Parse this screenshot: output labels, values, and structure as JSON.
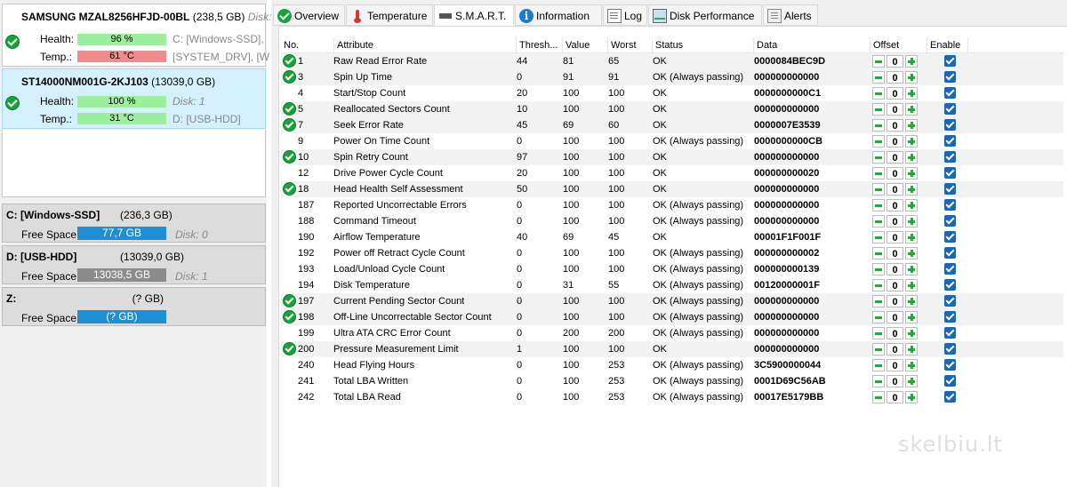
{
  "disks": [
    {
      "model": "SAMSUNG MZAL8256HFJD-00BL",
      "size": "(238,5 GB)",
      "extra": "Disk:",
      "health_label": "Health:",
      "health": "96 %",
      "temp_label": "Temp.:",
      "temp": "61 °C",
      "part1": "C: [Windows-SSD],",
      "part2": "[SYSTEM_DRV],  [W"
    },
    {
      "model": "ST14000NM001G-2KJ103",
      "size": "(13039,0 GB)",
      "health_label": "Health:",
      "health": "100 %",
      "temp_label": "Temp.:",
      "temp": "31 °C",
      "part1": "Disk: 1",
      "part2": "D: [USB-HDD]"
    }
  ],
  "volumes": [
    {
      "name": "C: [Windows-SSD]",
      "size": "(236,3 GB)",
      "free_label": "Free Space",
      "free": "77,7 GB",
      "free_fraction": 1.0,
      "disk": "Disk: 0"
    },
    {
      "name": "D: [USB-HDD]",
      "size": "(13039,0 GB)",
      "free_label": "Free Space",
      "free": "13038,5 GB",
      "free_fraction": 1.0,
      "disk": "Disk: 1"
    },
    {
      "name": "Z:",
      "size": "(? GB)",
      "free_label": "Free Space",
      "free": "(? GB)",
      "free_fraction": 1.0,
      "disk": ""
    }
  ],
  "tabs": [
    {
      "label": "Overview",
      "icon": "check-icon"
    },
    {
      "label": "Temperature",
      "icon": "thermometer-icon"
    },
    {
      "label": "S.M.A.R.T.",
      "icon": "drive-icon"
    },
    {
      "label": "Information",
      "icon": "info-icon"
    },
    {
      "label": "Log",
      "icon": "log-icon"
    },
    {
      "label": "Disk Performance",
      "icon": "chart-icon"
    },
    {
      "label": "Alerts",
      "icon": "alerts-icon"
    }
  ],
  "table": {
    "headers": [
      "No.",
      "Attribute",
      "Thresh...",
      "Value",
      "Worst",
      "Status",
      "Data",
      "Offset",
      "Enable"
    ],
    "rows": [
      {
        "ok": true,
        "no": "1",
        "attr": "Raw Read Error Rate",
        "thresh": "44",
        "value": "81",
        "worst": "65",
        "status": "OK",
        "data": "0000084BEC9D",
        "offset": "0"
      },
      {
        "ok": true,
        "no": "3",
        "attr": "Spin Up Time",
        "thresh": "0",
        "value": "91",
        "worst": "91",
        "status": "OK (Always passing)",
        "data": "000000000000",
        "offset": "0"
      },
      {
        "ok": false,
        "no": "4",
        "attr": "Start/Stop Count",
        "thresh": "20",
        "value": "100",
        "worst": "100",
        "status": "OK",
        "data": "0000000000C1",
        "offset": "0"
      },
      {
        "ok": true,
        "no": "5",
        "attr": "Reallocated Sectors Count",
        "thresh": "10",
        "value": "100",
        "worst": "100",
        "status": "OK",
        "data": "000000000000",
        "offset": "0"
      },
      {
        "ok": true,
        "no": "7",
        "attr": "Seek Error Rate",
        "thresh": "45",
        "value": "69",
        "worst": "60",
        "status": "OK",
        "data": "0000007E3539",
        "offset": "0"
      },
      {
        "ok": false,
        "no": "9",
        "attr": "Power On Time Count",
        "thresh": "0",
        "value": "100",
        "worst": "100",
        "status": "OK (Always passing)",
        "data": "0000000000CB",
        "offset": "0"
      },
      {
        "ok": true,
        "no": "10",
        "attr": "Spin Retry Count",
        "thresh": "97",
        "value": "100",
        "worst": "100",
        "status": "OK",
        "data": "000000000000",
        "offset": "0"
      },
      {
        "ok": false,
        "no": "12",
        "attr": "Drive Power Cycle Count",
        "thresh": "20",
        "value": "100",
        "worst": "100",
        "status": "OK",
        "data": "000000000020",
        "offset": "0"
      },
      {
        "ok": true,
        "no": "18",
        "attr": "Head Health Self Assessment",
        "thresh": "50",
        "value": "100",
        "worst": "100",
        "status": "OK",
        "data": "000000000000",
        "offset": "0"
      },
      {
        "ok": false,
        "no": "187",
        "attr": "Reported Uncorrectable Errors",
        "thresh": "0",
        "value": "100",
        "worst": "100",
        "status": "OK (Always passing)",
        "data": "000000000000",
        "offset": "0"
      },
      {
        "ok": false,
        "no": "188",
        "attr": "Command Timeout",
        "thresh": "0",
        "value": "100",
        "worst": "100",
        "status": "OK (Always passing)",
        "data": "000000000000",
        "offset": "0"
      },
      {
        "ok": false,
        "no": "190",
        "attr": "Airflow Temperature",
        "thresh": "40",
        "value": "69",
        "worst": "45",
        "status": "OK",
        "data": "00001F1F001F",
        "offset": "0"
      },
      {
        "ok": false,
        "no": "192",
        "attr": "Power off Retract Cycle Count",
        "thresh": "0",
        "value": "100",
        "worst": "100",
        "status": "OK (Always passing)",
        "data": "000000000002",
        "offset": "0"
      },
      {
        "ok": false,
        "no": "193",
        "attr": "Load/Unload Cycle Count",
        "thresh": "0",
        "value": "100",
        "worst": "100",
        "status": "OK (Always passing)",
        "data": "000000000139",
        "offset": "0"
      },
      {
        "ok": false,
        "no": "194",
        "attr": "Disk Temperature",
        "thresh": "0",
        "value": "31",
        "worst": "55",
        "status": "OK (Always passing)",
        "data": "00120000001F",
        "offset": "0"
      },
      {
        "ok": true,
        "no": "197",
        "attr": "Current Pending Sector Count",
        "thresh": "0",
        "value": "100",
        "worst": "100",
        "status": "OK (Always passing)",
        "data": "000000000000",
        "offset": "0"
      },
      {
        "ok": true,
        "no": "198",
        "attr": "Off-Line Uncorrectable Sector Count",
        "thresh": "0",
        "value": "100",
        "worst": "100",
        "status": "OK (Always passing)",
        "data": "000000000000",
        "offset": "0"
      },
      {
        "ok": false,
        "no": "199",
        "attr": "Ultra ATA CRC Error Count",
        "thresh": "0",
        "value": "200",
        "worst": "200",
        "status": "OK (Always passing)",
        "data": "000000000000",
        "offset": "0"
      },
      {
        "ok": true,
        "no": "200",
        "attr": "Pressure Measurement Limit",
        "thresh": "1",
        "value": "100",
        "worst": "100",
        "status": "OK",
        "data": "000000000000",
        "offset": "0"
      },
      {
        "ok": false,
        "no": "240",
        "attr": "Head Flying Hours",
        "thresh": "0",
        "value": "100",
        "worst": "253",
        "status": "OK (Always passing)",
        "data": "3C5900000044",
        "offset": "0"
      },
      {
        "ok": false,
        "no": "241",
        "attr": "Total LBA Written",
        "thresh": "0",
        "value": "100",
        "worst": "253",
        "status": "OK (Always passing)",
        "data": "0001D69C56AB",
        "offset": "0"
      },
      {
        "ok": false,
        "no": "242",
        "attr": "Total LBA Read",
        "thresh": "0",
        "value": "100",
        "worst": "253",
        "status": "OK (Always passing)",
        "data": "00017E5179BB",
        "offset": "0"
      }
    ]
  },
  "watermark": "skelbiu.lt"
}
